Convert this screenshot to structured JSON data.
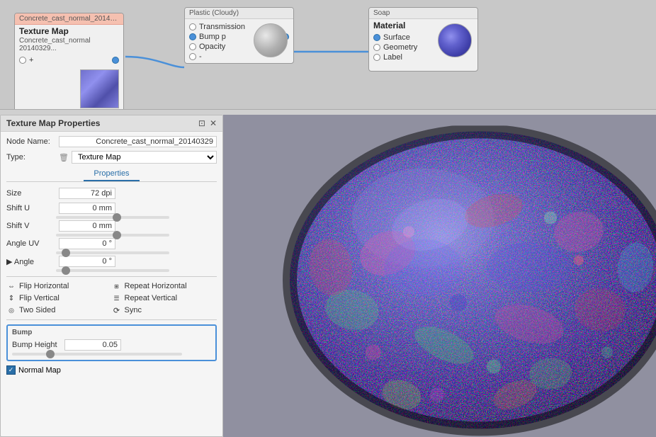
{
  "nodes": {
    "texture": {
      "header": "Concrete_cast_normal_20140...",
      "title": "Texture Map",
      "subtitle": "Concrete_cast_normal 20140329...",
      "port_out": "+"
    },
    "plastic": {
      "header": "Plastic (Cloudy)",
      "port_transmission": "Transmission",
      "port_bump": "Bump p",
      "port_opacity": "Opacity",
      "port_minus": "-"
    },
    "material": {
      "header": "Soap",
      "title": "Material",
      "port_surface": "Surface",
      "port_geometry": "Geometry",
      "port_label": "Label"
    }
  },
  "props": {
    "title": "Texture Map Properties",
    "restore_icon": "⊡",
    "close_icon": "✕",
    "node_name_label": "Node Name:",
    "node_name_value": "Concrete_cast_normal_20140329",
    "type_label": "Type:",
    "type_value": "Texture Map",
    "tab_properties": "Properties",
    "fields": {
      "size_label": "Size",
      "size_value": "72 dpi",
      "shift_u_label": "Shift U",
      "shift_u_value": "0 mm",
      "shift_v_label": "Shift V",
      "shift_v_value": "0 mm",
      "angle_uv_label": "Angle UV",
      "angle_uv_value": "0 °",
      "angle_label": "▶ Angle",
      "angle_value": "0 °"
    },
    "checkboxes": {
      "flip_h": "Flip Horizontal",
      "flip_v": "Flip Vertical",
      "two_sided": "Two Sided",
      "repeat_h": "Repeat Horizontal",
      "repeat_v": "Repeat Vertical",
      "sync": "Sync"
    },
    "bump_label": "Bump",
    "bump_height_label": "Bump Height",
    "bump_height_value": "0.05",
    "normal_map_label": "Normal Map"
  }
}
